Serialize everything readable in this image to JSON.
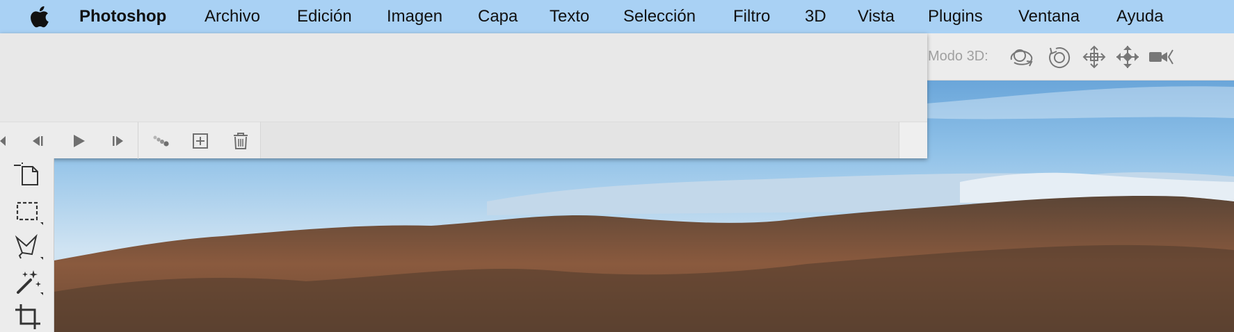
{
  "menubar": {
    "app_name": "Photoshop",
    "items": [
      "Archivo",
      "Edición",
      "Imagen",
      "Capa",
      "Texto",
      "Selección",
      "Filtro",
      "3D",
      "Vista",
      "Plugins",
      "Ventana",
      "Ayuda"
    ]
  },
  "options_bar": {
    "mode_label": "Modo 3D:",
    "icons": [
      "orbit-3d-icon",
      "roll-3d-icon",
      "pan-3d-icon",
      "slide-3d-icon",
      "scale-3d-camera-icon"
    ]
  },
  "timeline_controls": {
    "icons": [
      "go-to-first-frame-icon",
      "previous-frame-icon",
      "play-icon",
      "next-frame-icon",
      "tween-icon",
      "duplicate-frame-icon",
      "delete-frame-icon"
    ]
  },
  "tools": {
    "icons": [
      "artboard-tool-icon",
      "rectangular-marquee-icon",
      "polygonal-lasso-icon",
      "magic-wand-icon",
      "crop-tool-icon"
    ]
  },
  "colors": {
    "menubar_bg": "#a9d1f4",
    "panel_bg": "#e7e7e7",
    "icon_gray": "#6f6f6f"
  }
}
